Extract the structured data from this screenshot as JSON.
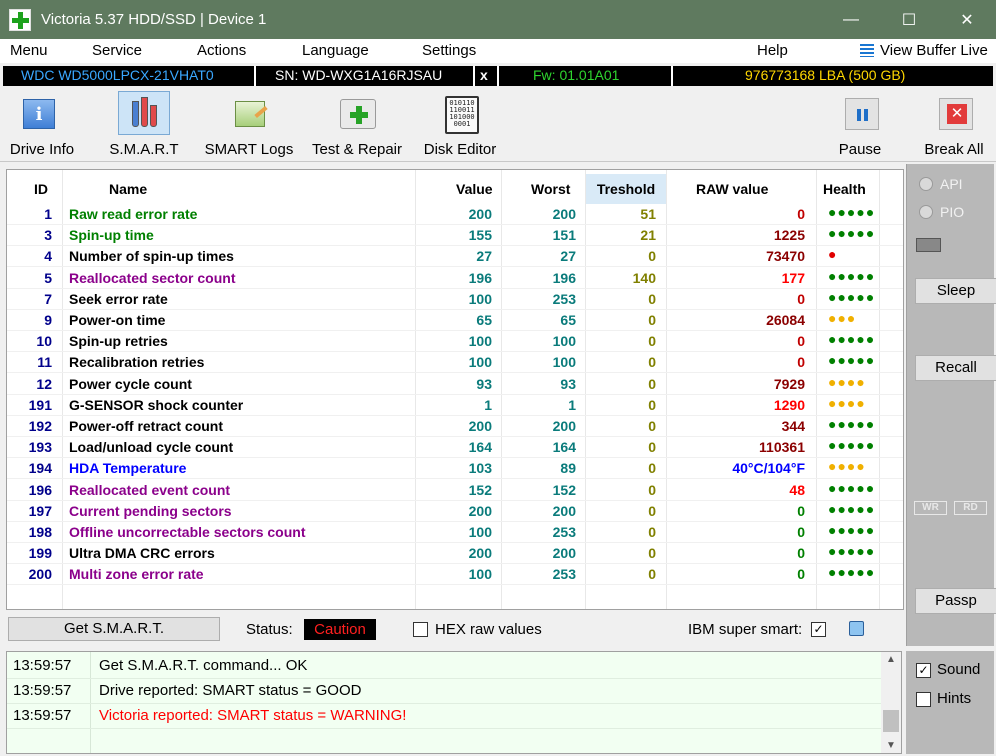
{
  "window": {
    "title": "Victoria 5.37 HDD/SSD | Device 1",
    "minimize": "—",
    "maximize": "☐",
    "close": "✕"
  },
  "menu": {
    "items": [
      "Menu",
      "Service",
      "Actions",
      "Language",
      "Settings",
      "Help"
    ],
    "view_buffer": "View Buffer Live"
  },
  "drive": {
    "model": "WDC WD5000LPCX-21VHAT0",
    "serial": "SN: WD-WXG1A16RJSAU",
    "x": "x",
    "firmware": "Fw: 01.01A01",
    "lba": "976773168 LBA (500 GB)"
  },
  "toolbar": {
    "drive_info": "Drive Info",
    "smart": "S.M.A.R.T",
    "smart_logs": "SMART Logs",
    "test_repair": "Test & Repair",
    "disk_editor": "Disk Editor",
    "pause": "Pause",
    "break_all": "Break All",
    "disk_editor_bits": "010110 110011 101000 0001"
  },
  "table": {
    "headers": {
      "id": "ID",
      "name": "Name",
      "value": "Value",
      "worst": "Worst",
      "treshold": "Treshold",
      "raw": "RAW value",
      "health": "Health"
    },
    "rows": [
      {
        "id": "1",
        "name": "Raw read error rate",
        "value": "200",
        "worst": "200",
        "treshold": "51",
        "raw": "0",
        "health": "●●●●●",
        "name_color": "#008000",
        "raw_color": "#c00000",
        "health_color": "#008000"
      },
      {
        "id": "3",
        "name": "Spin-up time",
        "value": "155",
        "worst": "151",
        "treshold": "21",
        "raw": "1225",
        "health": "●●●●●",
        "name_color": "#008000",
        "raw_color": "#8b0000",
        "health_color": "#008000"
      },
      {
        "id": "4",
        "name": "Number of spin-up times",
        "value": "27",
        "worst": "27",
        "treshold": "0",
        "raw": "73470",
        "health": "●",
        "name_color": "#000000",
        "raw_color": "#8b0000",
        "health_color": "#e00000"
      },
      {
        "id": "5",
        "name": "Reallocated sector count",
        "value": "196",
        "worst": "196",
        "treshold": "140",
        "raw": "177",
        "health": "●●●●●",
        "name_color": "#8b008b",
        "raw_color": "#ff0000",
        "health_color": "#008000"
      },
      {
        "id": "7",
        "name": "Seek error rate",
        "value": "100",
        "worst": "253",
        "treshold": "0",
        "raw": "0",
        "health": "●●●●●",
        "name_color": "#000000",
        "raw_color": "#c00000",
        "health_color": "#008000"
      },
      {
        "id": "9",
        "name": "Power-on time",
        "value": "65",
        "worst": "65",
        "treshold": "0",
        "raw": "26084",
        "health": "●●●",
        "name_color": "#000000",
        "raw_color": "#8b0000",
        "health_color": "#f0b000"
      },
      {
        "id": "10",
        "name": "Spin-up retries",
        "value": "100",
        "worst": "100",
        "treshold": "0",
        "raw": "0",
        "health": "●●●●●",
        "name_color": "#000000",
        "raw_color": "#c00000",
        "health_color": "#008000"
      },
      {
        "id": "11",
        "name": "Recalibration retries",
        "value": "100",
        "worst": "100",
        "treshold": "0",
        "raw": "0",
        "health": "●●●●●",
        "name_color": "#000000",
        "raw_color": "#c00000",
        "health_color": "#008000"
      },
      {
        "id": "12",
        "name": "Power cycle count",
        "value": "93",
        "worst": "93",
        "treshold": "0",
        "raw": "7929",
        "health": "●●●●",
        "name_color": "#000000",
        "raw_color": "#8b0000",
        "health_color": "#f0b000"
      },
      {
        "id": "191",
        "name": "G-SENSOR shock counter",
        "value": "1",
        "worst": "1",
        "treshold": "0",
        "raw": "1290",
        "health": "●●●●",
        "name_color": "#000000",
        "raw_color": "#ff0000",
        "health_color": "#f0b000"
      },
      {
        "id": "192",
        "name": "Power-off retract count",
        "value": "200",
        "worst": "200",
        "treshold": "0",
        "raw": "344",
        "health": "●●●●●",
        "name_color": "#000000",
        "raw_color": "#8b0000",
        "health_color": "#008000"
      },
      {
        "id": "193",
        "name": "Load/unload cycle count",
        "value": "164",
        "worst": "164",
        "treshold": "0",
        "raw": "110361",
        "health": "●●●●●",
        "name_color": "#000000",
        "raw_color": "#8b0000",
        "health_color": "#008000"
      },
      {
        "id": "194",
        "name": "HDA Temperature",
        "value": "103",
        "worst": "89",
        "treshold": "0",
        "raw": "40°C/104°F",
        "health": "●●●●",
        "name_color": "#0000ff",
        "raw_color": "#0000ff",
        "health_color": "#f0b000"
      },
      {
        "id": "196",
        "name": "Reallocated event count",
        "value": "152",
        "worst": "152",
        "treshold": "0",
        "raw": "48",
        "health": "●●●●●",
        "name_color": "#8b008b",
        "raw_color": "#ff0000",
        "health_color": "#008000"
      },
      {
        "id": "197",
        "name": "Current pending sectors",
        "value": "200",
        "worst": "200",
        "treshold": "0",
        "raw": "0",
        "health": "●●●●●",
        "name_color": "#8b008b",
        "raw_color": "#008000",
        "health_color": "#008000"
      },
      {
        "id": "198",
        "name": "Offline uncorrectable sectors count",
        "value": "100",
        "worst": "253",
        "treshold": "0",
        "raw": "0",
        "health": "●●●●●",
        "name_color": "#8b008b",
        "raw_color": "#008000",
        "health_color": "#008000"
      },
      {
        "id": "199",
        "name": "Ultra DMA CRC errors",
        "value": "200",
        "worst": "200",
        "treshold": "0",
        "raw": "0",
        "health": "●●●●●",
        "name_color": "#000000",
        "raw_color": "#008000",
        "health_color": "#008000"
      },
      {
        "id": "200",
        "name": "Multi zone error rate",
        "value": "100",
        "worst": "253",
        "treshold": "0",
        "raw": "0",
        "health": "●●●●●",
        "name_color": "#8b008b",
        "raw_color": "#008000",
        "health_color": "#008000"
      }
    ]
  },
  "status": {
    "get_smart": "Get S.M.A.R.T.",
    "label": "Status:",
    "value": "Caution",
    "hex_raw": "HEX raw values",
    "hex_checked": false,
    "ibm": "IBM super smart:",
    "ibm_checked": true
  },
  "side": {
    "api": "API",
    "pio": "PIO",
    "sleep": "Sleep",
    "recall": "Recall",
    "wr": "WR",
    "rd": "RD",
    "passp": "Passp",
    "sound": "Sound",
    "sound_checked": true,
    "hints": "Hints",
    "hints_checked": false
  },
  "log": [
    {
      "time": "13:59:57",
      "msg": "Get S.M.A.R.T. command... OK",
      "color": "#000000"
    },
    {
      "time": "13:59:57",
      "msg": "Drive reported: SMART status = GOOD",
      "color": "#000000"
    },
    {
      "time": "13:59:57",
      "msg": "Victoria reported: SMART status = WARNING!",
      "color": "#ff0000"
    }
  ]
}
